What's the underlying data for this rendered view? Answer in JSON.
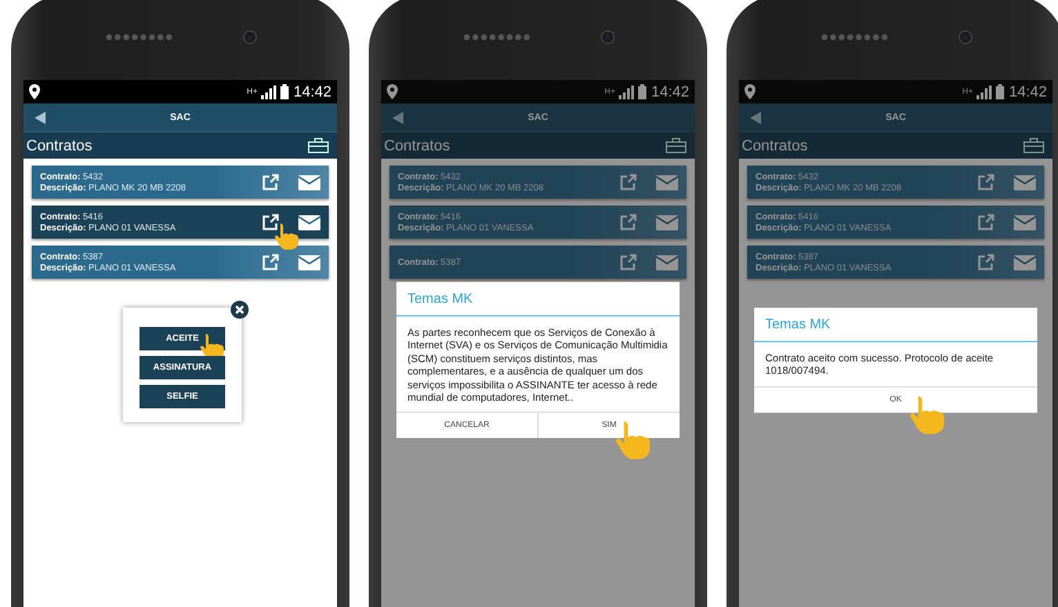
{
  "phones": [
    {
      "status": {
        "network": "H+",
        "time": "14:42"
      },
      "title": "SAC",
      "section": "Contratos",
      "dimmed": false,
      "contracts": [
        {
          "contract_label": "Contrato:",
          "number": "5432",
          "description_label": "Descrição:",
          "description": "PLANO MK 20 MB 2208",
          "selected": false,
          "pointed": false
        },
        {
          "contract_label": "Contrato:",
          "number": "5416",
          "description_label": "Descrição:",
          "description": "PLANO 01 VANESSA",
          "selected": true,
          "pointed": true
        },
        {
          "contract_label": "Contrato:",
          "number": "5387",
          "description_label": "Descrição:",
          "description": "PLANO 01 VANESSA",
          "selected": false,
          "pointed": false
        }
      ],
      "overlay": {
        "kind": "menu",
        "buttons": [
          {
            "label": "ACEITE",
            "pointed": true
          },
          {
            "label": "ASSINATURA",
            "pointed": false
          },
          {
            "label": "SELFIE",
            "pointed": false
          }
        ]
      }
    },
    {
      "status": {
        "network": "H+",
        "time": "14:42"
      },
      "title": "SAC",
      "section": "Contratos",
      "dimmed": true,
      "contracts": [
        {
          "contract_label": "Contrato:",
          "number": "5432",
          "description_label": "Descrição:",
          "description": "PLANO MK 20 MB 2208",
          "selected": false,
          "pointed": false
        },
        {
          "contract_label": "Contrato:",
          "number": "5416",
          "description_label": "Descrição:",
          "description": "PLANO 01 VANESSA",
          "selected": false,
          "pointed": false
        },
        {
          "contract_label": "Contrato:",
          "number": "5387",
          "selected": false,
          "pointed": false
        }
      ],
      "overlay": {
        "kind": "dialog",
        "title": "Temas MK",
        "message": "As partes reconhecem que os Serviços de Conexão à Internet (SVA) e os Serviços de Comunicação Multimidia (SCM) constituem serviços distintos, mas complementares, e a ausência de qualquer um dos serviços impossibilita o ASSINANTE ter acesso à rede mundial de computadores, Internet..",
        "buttons": [
          {
            "label": "CANCELAR",
            "pointed": false
          },
          {
            "label": "SIM",
            "pointed": true
          }
        ]
      }
    },
    {
      "status": {
        "network": "H+",
        "time": "14:42"
      },
      "title": "SAC",
      "section": "Contratos",
      "dimmed": true,
      "contracts": [
        {
          "contract_label": "Contrato:",
          "number": "5432",
          "description_label": "Descrição:",
          "description": "PLANO MK 20 MB 2208",
          "selected": false,
          "pointed": false
        },
        {
          "contract_label": "Contrato:",
          "number": "5416",
          "description_label": "Descrição:",
          "description": "PLANO 01 VANESSA",
          "selected": false,
          "pointed": false
        },
        {
          "contract_label": "Contrato:",
          "number": "5387",
          "description_label": "Descrição:",
          "description": "PLANO 01 VANESSA",
          "selected": false,
          "pointed": false
        }
      ],
      "overlay": {
        "kind": "dialog",
        "title": "Temas MK",
        "message": "Contrato aceito com sucesso. Protocolo de aceite 1018/007494.",
        "buttons": [
          {
            "label": "OK",
            "pointed": true
          }
        ]
      }
    }
  ]
}
